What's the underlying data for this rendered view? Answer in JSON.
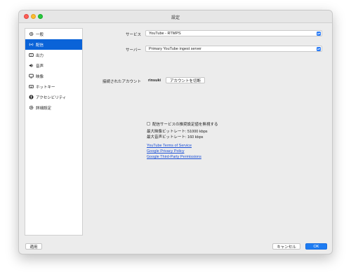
{
  "window": {
    "title": "設定"
  },
  "sidebar": {
    "items": [
      {
        "label": "一般",
        "icon": "gear-icon"
      },
      {
        "label": "配信",
        "icon": "broadcast-icon"
      },
      {
        "label": "出力",
        "icon": "output-icon"
      },
      {
        "label": "音声",
        "icon": "speaker-icon"
      },
      {
        "label": "映像",
        "icon": "monitor-icon"
      },
      {
        "label": "ホットキー",
        "icon": "keyboard-icon"
      },
      {
        "label": "アクセシビリティ",
        "icon": "accessibility-icon"
      },
      {
        "label": "詳細設定",
        "icon": "advanced-gear-icon"
      }
    ],
    "active_index": 1
  },
  "stream": {
    "service_label": "サービス",
    "service_value": "YouTube - RTMPS",
    "server_label": "サーバー",
    "server_value": "Primary YouTube ingest server",
    "account_label": "接続されたアカウント",
    "account_name": "rinsuki",
    "disconnect_label": "アカウントを切断",
    "ignore_recommended_label": "配信サービスの推奨設定値を無視する",
    "max_video_bitrate": "最大映像ビットレート: 51000 kbps",
    "max_audio_bitrate": "最大音声ビットレート: 160 kbps",
    "links": [
      "YouTube Terms of Service",
      "Google Privacy Policy",
      "Google Third-Party Permissions"
    ]
  },
  "footer": {
    "apply_label": "適用",
    "cancel_label": "キャンセル",
    "ok_label": "OK"
  },
  "colors": {
    "accent": "#1e7cf2",
    "sidebar_active": "#0a63d8",
    "link": "#1a4fd6"
  }
}
